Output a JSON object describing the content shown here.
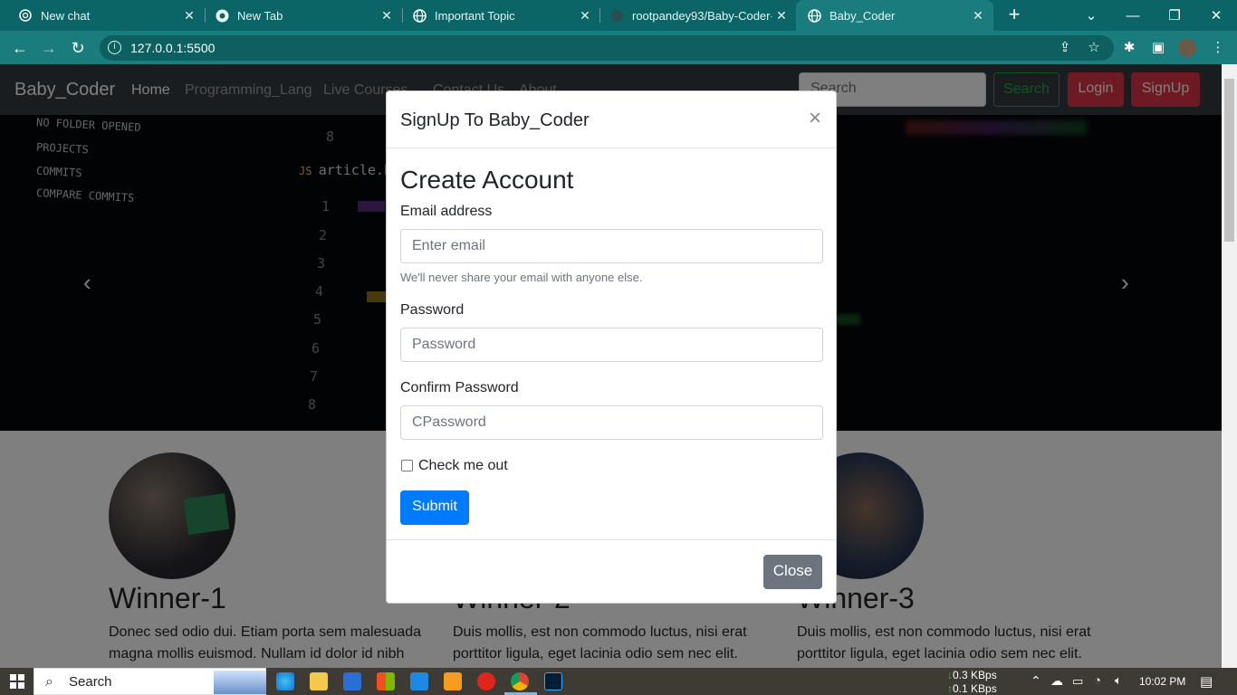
{
  "browser": {
    "tabs": [
      {
        "title": "New chat",
        "icon": "openai-icon"
      },
      {
        "title": "New Tab",
        "icon": "chrome-icon"
      },
      {
        "title": "Important Topic",
        "icon": "globe-icon"
      },
      {
        "title": "rootpandey93/Baby-Coder-E",
        "icon": "github-icon"
      },
      {
        "title": "Baby_Coder",
        "icon": "globe-icon",
        "active": true
      }
    ],
    "url": "127.0.0.1:5500"
  },
  "navbar": {
    "brand": "Baby_Coder",
    "links": [
      "Home",
      "Programming_Lang",
      "Live Courses",
      "Contact Us",
      "About"
    ],
    "search_placeholder": "Search",
    "search_button": "Search",
    "login_button": "Login",
    "signup_button": "SignUp"
  },
  "hero": {
    "sidebar_lines": [
      "NO FOLDER OPENED",
      "PROJECTS",
      "COMMITS",
      "COMPARE COMMITS"
    ],
    "file_tab": "article.htm",
    "line_numbers": [
      "8",
      "1",
      "2",
      "3",
      "4",
      "5",
      "6",
      "7",
      "8"
    ]
  },
  "winners": [
    {
      "title": "Winner-1",
      "text": "Donec sed odio dui. Etiam porta sem malesuada magna mollis euismod. Nullam id dolor id nibh"
    },
    {
      "title": "Winner-2",
      "text": "Duis mollis, est non commodo luctus, nisi erat porttitor ligula, eget lacinia odio sem nec elit."
    },
    {
      "title": "Winner-3",
      "text": "Duis mollis, est non commodo luctus, nisi erat porttitor ligula, eget lacinia odio sem nec elit."
    }
  ],
  "modal": {
    "title": "SignUp To Baby_Coder",
    "close_glyph": "×",
    "heading": "Create Account",
    "email_label": "Email address",
    "email_placeholder": "Enter email",
    "email_help": "We'll never share your email with anyone else.",
    "password_label": "Password",
    "password_placeholder": "Password",
    "confirm_label": "Confirm Password",
    "confirm_placeholder": "CPassword",
    "check_label": "Check me out",
    "submit": "Submit",
    "close": "Close"
  },
  "taskbar": {
    "search": "Search",
    "net_down": "0.3 KBps",
    "net_up": "0.1 KBps",
    "time": "10:02 PM"
  },
  "colors": {
    "primary": "#007bff",
    "danger": "#c82333",
    "success": "#28a745",
    "secondary": "#6c757d",
    "chrome": "#1a7c7c"
  }
}
